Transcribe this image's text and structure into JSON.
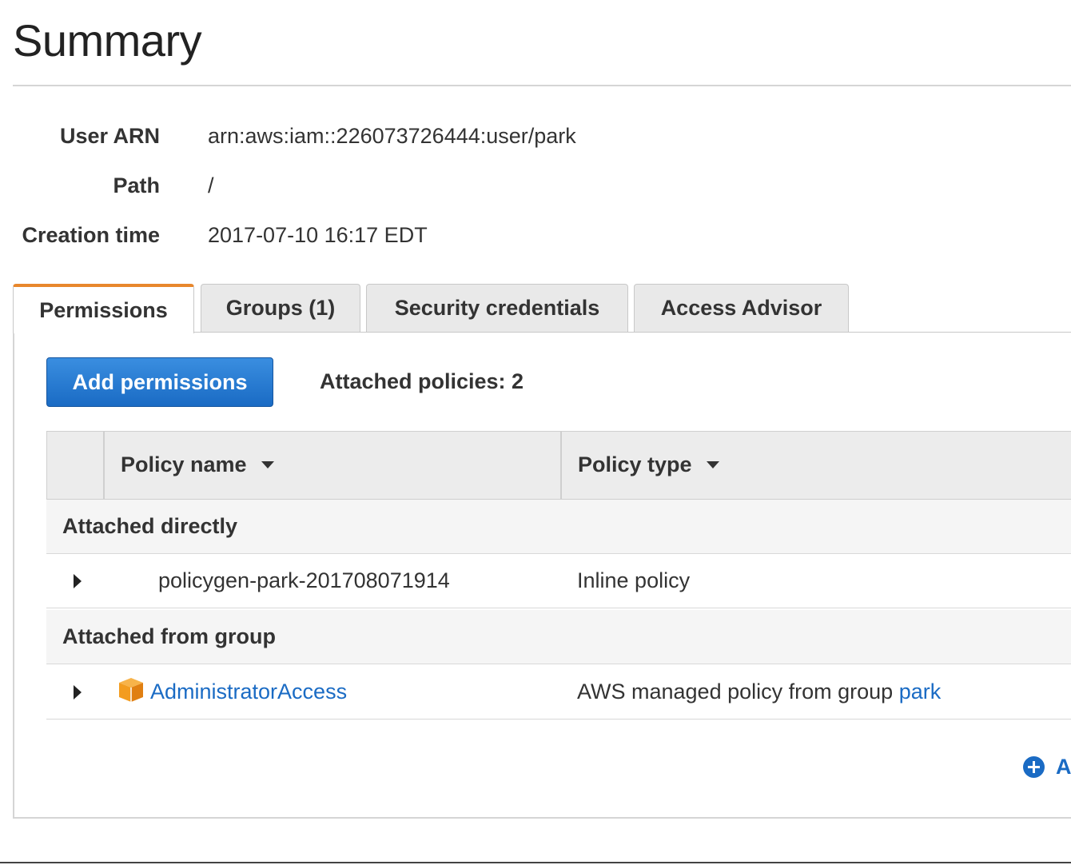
{
  "page": {
    "title": "Summary"
  },
  "summary": {
    "user_arn_label": "User ARN",
    "user_arn_value": "arn:aws:iam::226073726444:user/park",
    "path_label": "Path",
    "path_value": "/",
    "creation_time_label": "Creation time",
    "creation_time_value": "2017-07-10 16:17 EDT"
  },
  "tabs": [
    {
      "label": "Permissions",
      "active": true
    },
    {
      "label": "Groups (1)",
      "active": false
    },
    {
      "label": "Security credentials",
      "active": false
    },
    {
      "label": "Access Advisor",
      "active": false
    }
  ],
  "permissions": {
    "add_button_label": "Add permissions",
    "attached_count_text": "Attached policies: 2",
    "columns": {
      "policy_name": "Policy name",
      "policy_type": "Policy type"
    },
    "groups": [
      {
        "label": "Attached directly",
        "rows": [
          {
            "policy_name": "policygen-park-201708071914",
            "policy_type": "Inline policy"
          }
        ]
      },
      {
        "label": "Attached from group",
        "rows": [
          {
            "policy_name": "AdministratorAccess",
            "icon": "aws-managed-policy-cube-icon",
            "policy_type_prefix": "AWS managed policy from group",
            "policy_type_link": "park"
          }
        ]
      }
    ],
    "add_inline_label": "A"
  },
  "colors": {
    "accent_orange": "#e8872c",
    "primary_blue": "#1a6bc4",
    "policy_icon_orange": "#f39c1f"
  }
}
